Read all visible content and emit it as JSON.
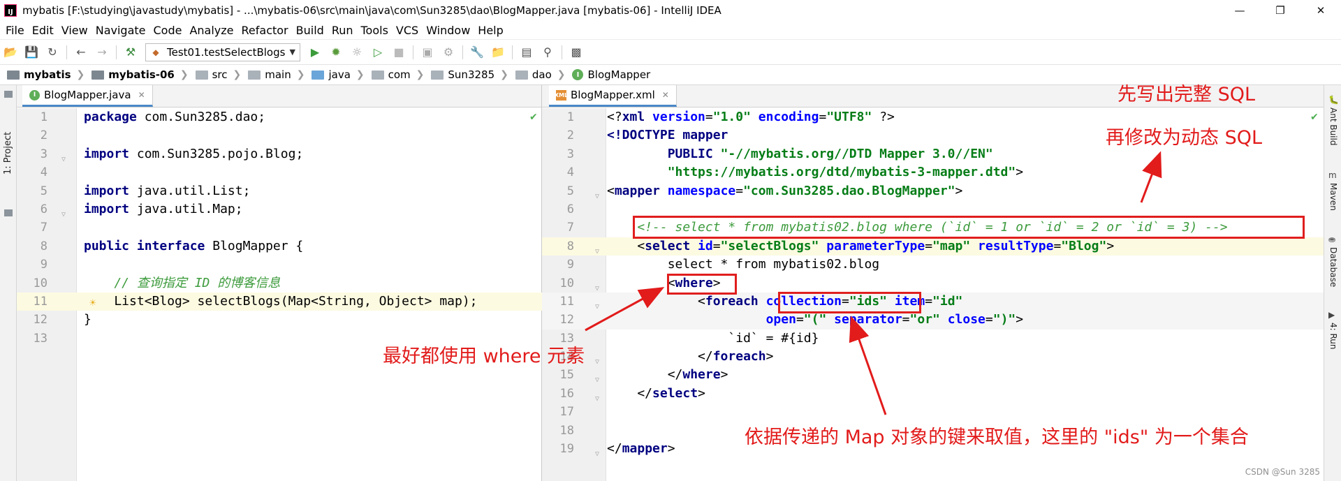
{
  "window": {
    "logo_text": "IJ",
    "title": "mybatis [F:\\studying\\javastudy\\mybatis] - ...\\mybatis-06\\src\\main\\java\\com\\Sun3285\\dao\\BlogMapper.java [mybatis-06] - IntelliJ IDEA",
    "minimize": "—",
    "maximize": "❐",
    "close": "✕"
  },
  "menu": [
    "File",
    "Edit",
    "View",
    "Navigate",
    "Code",
    "Analyze",
    "Refactor",
    "Build",
    "Run",
    "Tools",
    "VCS",
    "Window",
    "Help"
  ],
  "toolbar": {
    "run_config": "Test01.testSelectBlogs"
  },
  "breadcrumbs": [
    "mybatis",
    "mybatis-06",
    "src",
    "main",
    "java",
    "com",
    "Sun3285",
    "dao",
    "BlogMapper"
  ],
  "side_left": {
    "project_label": "1: Project"
  },
  "side_right": [
    "Ant Build",
    "Maven",
    "Database",
    "4: Run"
  ],
  "left_editor": {
    "tab": "BlogMapper.java",
    "lines": [
      {
        "n": "1",
        "parts": [
          [
            "kw",
            "package"
          ],
          [
            "",
            " com.Sun3285.dao;"
          ]
        ]
      },
      {
        "n": "2",
        "parts": []
      },
      {
        "n": "3",
        "parts": [
          [
            "kw",
            "import"
          ],
          [
            "",
            " com.Sun3285.pojo.Blog;"
          ]
        ]
      },
      {
        "n": "4",
        "parts": []
      },
      {
        "n": "5",
        "parts": [
          [
            "kw",
            "import"
          ],
          [
            "",
            " java.util.List;"
          ]
        ]
      },
      {
        "n": "6",
        "parts": [
          [
            "kw",
            "import"
          ],
          [
            "",
            " java.util.Map;"
          ]
        ]
      },
      {
        "n": "7",
        "parts": []
      },
      {
        "n": "8",
        "parts": [
          [
            "kw",
            "public interface"
          ],
          [
            "",
            " BlogMapper {"
          ]
        ]
      },
      {
        "n": "9",
        "parts": []
      },
      {
        "n": "10",
        "parts": [
          [
            "cmt",
            "    // 查询指定 ID 的博客信息"
          ]
        ]
      },
      {
        "n": "11",
        "parts": [
          [
            "",
            "    List<Blog> selectBlogs(Map<String, Object> map);"
          ]
        ]
      },
      {
        "n": "12",
        "parts": [
          [
            "",
            "}"
          ]
        ]
      },
      {
        "n": "13",
        "parts": []
      }
    ]
  },
  "right_editor": {
    "tab": "BlogMapper.xml",
    "lines": [
      {
        "n": "1",
        "parts": [
          [
            "",
            "<?"
          ],
          [
            "tag",
            "xml"
          ],
          [
            "attr",
            " version"
          ],
          [
            "",
            "="
          ],
          [
            "str",
            "\"1.0\""
          ],
          [
            "attr",
            " encoding"
          ],
          [
            "",
            "="
          ],
          [
            "str",
            "\"UTF8\""
          ],
          [
            "",
            " ?>"
          ]
        ]
      },
      {
        "n": "2",
        "parts": [
          [
            "tag",
            "<!DOCTYPE mapper"
          ]
        ]
      },
      {
        "n": "3",
        "parts": [
          [
            "",
            "        "
          ],
          [
            "tag",
            "PUBLIC"
          ],
          [
            "",
            " "
          ],
          [
            "str",
            "\"-//mybatis.org//DTD Mapper 3.0//EN\""
          ]
        ]
      },
      {
        "n": "4",
        "parts": [
          [
            "",
            "        "
          ],
          [
            "str",
            "\"https://mybatis.org/dtd/mybatis-3-mapper.dtd\""
          ],
          [
            "",
            ">"
          ]
        ]
      },
      {
        "n": "5",
        "parts": [
          [
            "",
            "<"
          ],
          [
            "tag",
            "mapper"
          ],
          [
            "attr",
            " namespace"
          ],
          [
            "",
            "="
          ],
          [
            "str",
            "\"com.Sun3285.dao.BlogMapper\""
          ],
          [
            "",
            ">"
          ]
        ]
      },
      {
        "n": "6",
        "parts": []
      },
      {
        "n": "7",
        "parts": [
          [
            "cmt",
            "    <!-- select * from mybatis02.blog where (`id` = 1 or `id` = 2 or `id` = 3) -->"
          ]
        ]
      },
      {
        "n": "8",
        "parts": [
          [
            "",
            "    <"
          ],
          [
            "tag",
            "select"
          ],
          [
            "attr",
            " id"
          ],
          [
            "",
            "="
          ],
          [
            "str",
            "\"selectBlogs\""
          ],
          [
            "attr",
            " parameterType"
          ],
          [
            "",
            "="
          ],
          [
            "str",
            "\"map\""
          ],
          [
            "attr",
            " resultType"
          ],
          [
            "",
            "="
          ],
          [
            "str",
            "\"Blog\""
          ],
          [
            "",
            ">"
          ]
        ]
      },
      {
        "n": "9",
        "parts": [
          [
            "",
            "        select * from mybatis02.blog"
          ]
        ]
      },
      {
        "n": "10",
        "parts": [
          [
            "",
            "        <"
          ],
          [
            "tag",
            "where"
          ],
          [
            "",
            ">"
          ]
        ]
      },
      {
        "n": "11",
        "parts": [
          [
            "",
            "            <"
          ],
          [
            "tag",
            "foreach"
          ],
          [
            "",
            " "
          ],
          [
            "attr",
            "collection"
          ],
          [
            "",
            "="
          ],
          [
            "str",
            "\"ids\""
          ],
          [
            "attr",
            " item"
          ],
          [
            "",
            "="
          ],
          [
            "str",
            "\"id\""
          ]
        ]
      },
      {
        "n": "12",
        "parts": [
          [
            "",
            "                     "
          ],
          [
            "attr",
            "open"
          ],
          [
            "",
            "="
          ],
          [
            "str",
            "\"(\""
          ],
          [
            "attr",
            " separator"
          ],
          [
            "",
            "="
          ],
          [
            "str",
            "\"or\""
          ],
          [
            "attr",
            " close"
          ],
          [
            "",
            "="
          ],
          [
            "str",
            "\")\""
          ],
          [
            "",
            ">"
          ]
        ]
      },
      {
        "n": "13",
        "parts": [
          [
            "",
            "                `id` = #{id}"
          ]
        ]
      },
      {
        "n": "14",
        "parts": [
          [
            "",
            "            </"
          ],
          [
            "tag",
            "foreach"
          ],
          [
            "",
            ">"
          ]
        ]
      },
      {
        "n": "15",
        "parts": [
          [
            "",
            "        </"
          ],
          [
            "tag",
            "where"
          ],
          [
            "",
            ">"
          ]
        ]
      },
      {
        "n": "16",
        "parts": [
          [
            "",
            "    </"
          ],
          [
            "tag",
            "select"
          ],
          [
            "",
            ">"
          ]
        ]
      },
      {
        "n": "17",
        "parts": []
      },
      {
        "n": "18",
        "parts": []
      },
      {
        "n": "19",
        "parts": [
          [
            "",
            "</"
          ],
          [
            "tag",
            "mapper"
          ],
          [
            "",
            ">"
          ]
        ]
      }
    ]
  },
  "annotations": {
    "full_sql": "先写出完整 SQL",
    "dynamic_sql": "再修改为动态 SQL",
    "use_where": "最好都使用 where 元素",
    "map_key": "依据传递的 Map 对象的键来取值，这里的 \"ids\" 为一个集合"
  },
  "watermark": "CSDN @Sun 3285",
  "colors": {
    "annotation_red": "#e21b1b",
    "keyword": "#000080",
    "string": "#067d17",
    "comment": "#3d9b3d",
    "attribute": "#0000ff"
  }
}
